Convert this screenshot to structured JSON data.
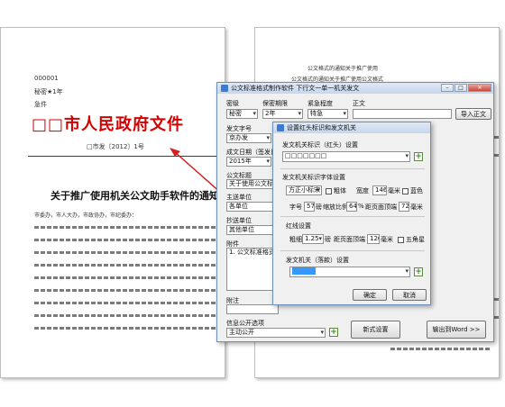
{
  "left_doc": {
    "doc_number": "000001",
    "secret_level": "秘密★1年",
    "urgency": "急件",
    "red_header": "□□市人民政府文件",
    "issue_number": "□市发〔2012〕1号",
    "doc_title": "关于推广使用机关公文助手软件的通知",
    "salutation": "市委办，市人大办，市政协办，市纪委办："
  },
  "right_doc": {
    "body_snippet_1": "公文格式的通知关于推广使用",
    "body_snippet_2": "公文格式的通知关于推广使用公文格式"
  },
  "main_window": {
    "title": "公文标准格式制作软件    下行文一单一机关发文",
    "labels": {
      "secret": "密级",
      "secret_term": "保密期限",
      "urgency": "紧急程度",
      "doc_number": "发文字号",
      "date": "成文日期（签发日期）",
      "doc_title": "公文标题",
      "main_recipient": "主送单位",
      "cc": "抄送单位",
      "attachment": "附件",
      "note": "附注",
      "publish": "信息公开选项",
      "body": "正文"
    },
    "values": {
      "secret": "秘密",
      "secret_term": "2年",
      "urgency": "特急",
      "doc_number": "京办发",
      "date": "2015年",
      "doc_title": "关于使用公文标准格式",
      "main_recipient": "各单位",
      "cc": "其他单位",
      "attachment": "1. 公文标准格式",
      "publish": "主动公开"
    },
    "buttons": {
      "import_body": "导入正文",
      "new_setting": "新式设置",
      "export_word": "输出到Word >>"
    }
  },
  "dialog": {
    "title": "设置红头标识和发文机关",
    "section_issuer_title": "发文机关标识（红头）设置",
    "issuer_value": "□□□□□□□",
    "section_font_title": "发文机关标识字体设置",
    "font_name": "方正小标宋",
    "bold_label": "粗体",
    "width_label": "宽度",
    "width_value": "146",
    "width_unit": "毫米",
    "color_label": "蓝色",
    "size_label": "字号",
    "size_value": "57",
    "size_unit": "磅",
    "ratio_label": "缩放比例",
    "ratio_value": "64",
    "ratio_unit": "%",
    "top_margin_label": "距页面顶端",
    "top_margin_value": "72",
    "top_margin_unit": "毫米",
    "section_line_title": "红线设置",
    "line_weight_label": "粗细",
    "line_weight_value": "1.25",
    "line_weight_unit": "磅",
    "line_dist_label": "距页面顶端",
    "line_dist_value": "120",
    "line_dist_unit": "毫米",
    "star_label": "五角星",
    "section_sign_title": "发文机关（落款）设置",
    "sign_value": "■■■■",
    "ok_button": "确定",
    "cancel_button": "取消"
  },
  "colors": {
    "red_header": "#d40000",
    "arrow": "#d62020",
    "window_border": "#6b8fb8"
  }
}
